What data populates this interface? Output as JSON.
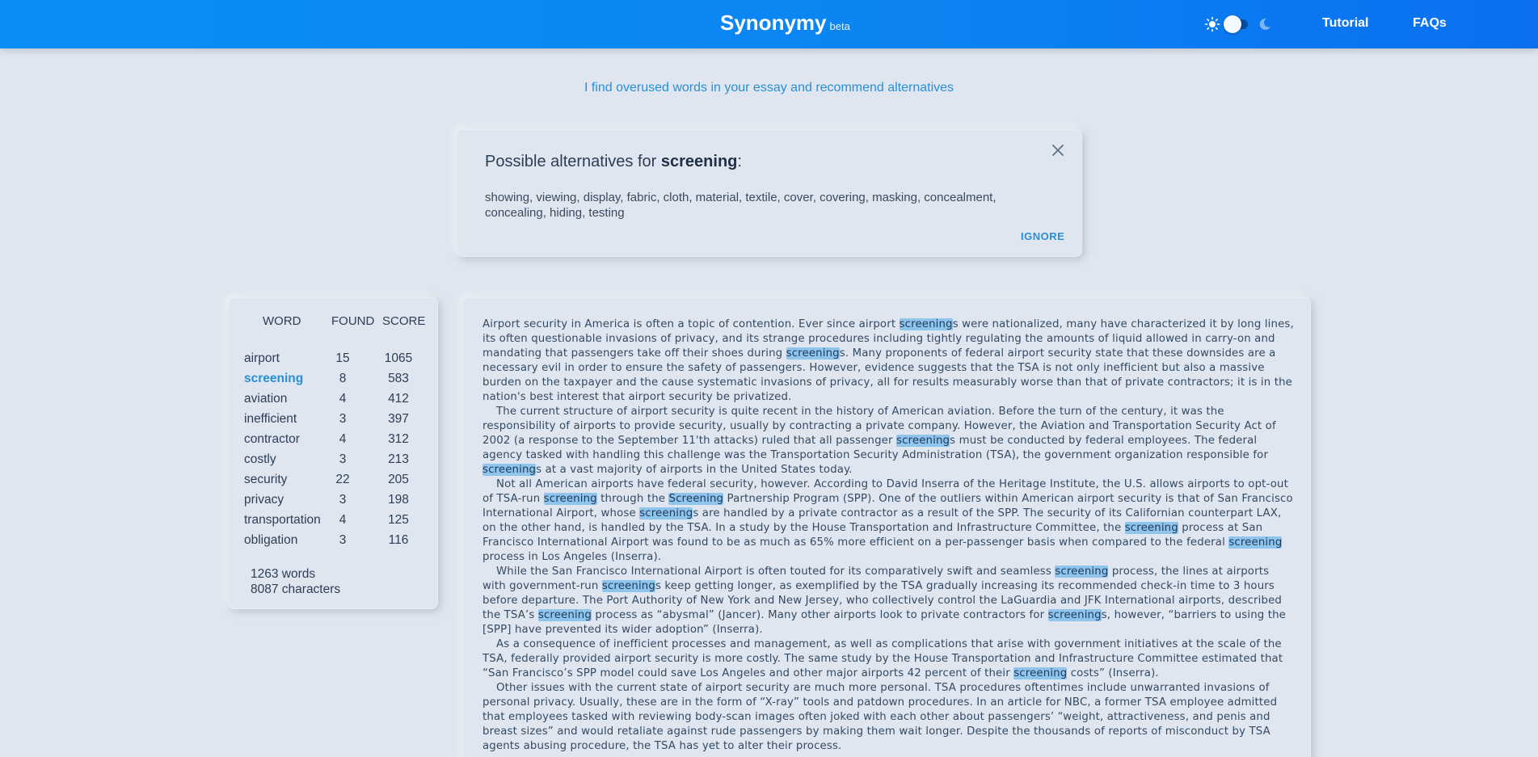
{
  "header": {
    "brand": "Synonymy",
    "brand_tag": "beta",
    "nav": {
      "tutorial": "Tutorial",
      "faqs": "FAQs"
    },
    "theme_toggle": {
      "left_icon": "sun-icon",
      "right_icon": "moon-icon",
      "state": "light"
    }
  },
  "tagline": "I find overused words in your essay and recommend alternatives",
  "alternatives": {
    "prefix": "Possible alternatives for ",
    "word": "screening",
    "suffix": ":",
    "list": "showing, viewing, display, fabric, cloth, material, textile, cover, covering, masking, concealment, concealing, hiding, testing",
    "ignore_label": "IGNORE",
    "close_icon": "close-icon"
  },
  "word_table": {
    "headers": {
      "word": "WORD",
      "found": "FOUND",
      "score": "SCORE"
    },
    "rows": [
      {
        "word": "airport",
        "found": "15",
        "score": "1065"
      },
      {
        "word": "screening",
        "found": "8",
        "score": "583"
      },
      {
        "word": "aviation",
        "found": "4",
        "score": "412"
      },
      {
        "word": "inefficient",
        "found": "3",
        "score": "397"
      },
      {
        "word": "contractor",
        "found": "4",
        "score": "312"
      },
      {
        "word": "costly",
        "found": "3",
        "score": "213"
      },
      {
        "word": "security",
        "found": "22",
        "score": "205"
      },
      {
        "word": "privacy",
        "found": "3",
        "score": "198"
      },
      {
        "word": "transportation",
        "found": "4",
        "score": "125"
      },
      {
        "word": "obligation",
        "found": "3",
        "score": "116"
      }
    ],
    "active_word": "screening",
    "stats": {
      "words": "1263 words",
      "characters": "8087 characters"
    }
  },
  "colors": {
    "accent": "#2a8fd6",
    "topbar": "#0b84f2",
    "background": "#dfe6ef",
    "highlight": "#8fc4ec"
  },
  "essay": {
    "highlight_word": "screening",
    "paragraphs": [
      [
        {
          "t": "Airport security in America is often a topic of contention. Ever since airport "
        },
        {
          "t": "screening",
          "hl": true
        },
        {
          "t": "s were nationalized, many have characterized it by long lines, its often questionable invasions of privacy, and its strange procedures including tightly regulating the amounts of liquid allowed in carry-on and mandating that passengers take off their shoes during "
        },
        {
          "t": "screening",
          "hl": true
        },
        {
          "t": "s. Many proponents of federal airport security state that these downsides are a necessary evil in order to ensure the safety of passengers. However, evidence suggests that the TSA is not only inefficient but also a massive burden on the taxpayer and the cause systematic invasions of privacy, all for results measurably worse than that of private contractors; it is in the nation's best interest that airport security be privatized."
        }
      ],
      [
        {
          "t": "The current structure of airport security is quite recent in the history of American aviation. Before the turn of the century, it was the responsibility of airports to provide security, usually by contracting a private company. However, the Aviation and Transportation Security Act of 2002 (a response to the September 11'th attacks) ruled that all passenger "
        },
        {
          "t": "screening",
          "hl": true
        },
        {
          "t": "s must be conducted by federal employees. The federal agency tasked with handling this challenge was the Transportation Security Administration (TSA), the government organization responsible for "
        },
        {
          "t": "screening",
          "hl": true
        },
        {
          "t": "s at a vast majority of airports in the United States today."
        }
      ],
      [
        {
          "t": "Not all American airports have federal security, however. According to David Inserra of the Heritage Institute, the U.S. allows airports to opt-out of TSA-run "
        },
        {
          "t": "screening",
          "hl": true
        },
        {
          "t": " through the "
        },
        {
          "t": "Screening",
          "hl": true
        },
        {
          "t": " Partnership Program (SPP). One of the outliers within American airport security is that of San Francisco International Airport, whose "
        },
        {
          "t": "screening",
          "hl": true
        },
        {
          "t": "s are handled by a private contractor as a result of the SPP. The security of its Californian counterpart LAX, on the other hand, is handled by the TSA. In a study by the House Transportation and Infrastructure Committee, the "
        },
        {
          "t": "screening",
          "hl": true
        },
        {
          "t": " process at San Francisco International Airport was found to be as much as 65% more efficient on a per-passenger basis when compared to the federal "
        },
        {
          "t": "screening",
          "hl": true
        },
        {
          "t": " process in Los Angeles (Inserra)."
        }
      ],
      [
        {
          "t": "While the San Francisco International Airport is often touted for its comparatively swift and seamless "
        },
        {
          "t": "screening",
          "hl": true
        },
        {
          "t": " process, the lines at airports with government-run "
        },
        {
          "t": "screening",
          "hl": true
        },
        {
          "t": "s keep getting longer, as exemplified by the TSA gradually increasing its recommended check-in time to 3 hours before departure. The Port Authority of New York and New Jersey, who collectively control the LaGuardia and JFK International airports, described the TSA’s "
        },
        {
          "t": "screening",
          "hl": true
        },
        {
          "t": " process as “abysmal” (Jancer). Many other airports look to private contractors for "
        },
        {
          "t": "screening",
          "hl": true
        },
        {
          "t": "s, however, “barriers to using the [SPP] have prevented its wider adoption” (Inserra)."
        }
      ],
      [
        {
          "t": "As a consequence of inefficient processes and management, as well as complications that arise with government initiatives at the scale of the TSA, federally provided airport security is more costly. The same study by the House Transportation and Infrastructure Committee estimated that “San Francisco’s SPP model could save Los Angeles and other major airports 42 percent of their "
        },
        {
          "t": "screening",
          "hl": true
        },
        {
          "t": " costs” (Inserra)."
        }
      ],
      [
        {
          "t": "Other issues with the current state of airport security are much more personal. TSA procedures oftentimes include unwarranted invasions of personal privacy. Usually, these are in the form of “X-ray” tools and patdown procedures. In an article for NBC, a former TSA employee admitted that employees tasked with reviewing body-scan images often joked with each other about passengers’ “weight, attractiveness, and penis and breast sizes” and would retaliate against rude passengers by making them wait longer. Despite the thousands of reports of misconduct by TSA agents abusing procedure, the TSA has yet to alter their process."
        }
      ]
    ]
  }
}
